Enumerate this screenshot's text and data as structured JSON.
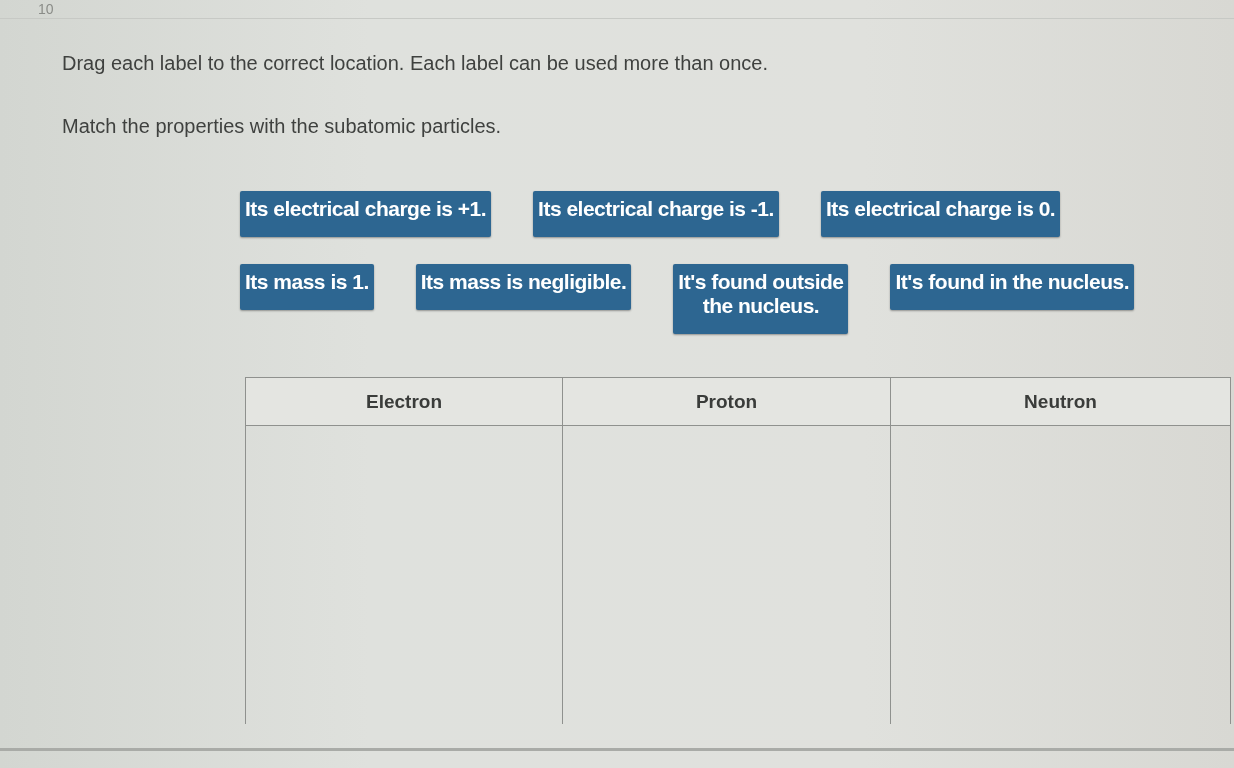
{
  "question_number": "10",
  "instructions": [
    "Drag each label to the correct location. Each label can be used more than once.",
    "Match the properties with the subatomic particles."
  ],
  "label_rows": [
    [
      "Its electrical charge is +1.",
      "Its electrical charge is -1.",
      "Its electrical charge is 0."
    ],
    [
      "Its mass is 1.",
      "Its mass is negligible.",
      "It's found outside\nthe nucleus.",
      "It's found in the nucleus."
    ]
  ],
  "table": {
    "columns": [
      "Electron",
      "Proton",
      "Neutron"
    ]
  }
}
